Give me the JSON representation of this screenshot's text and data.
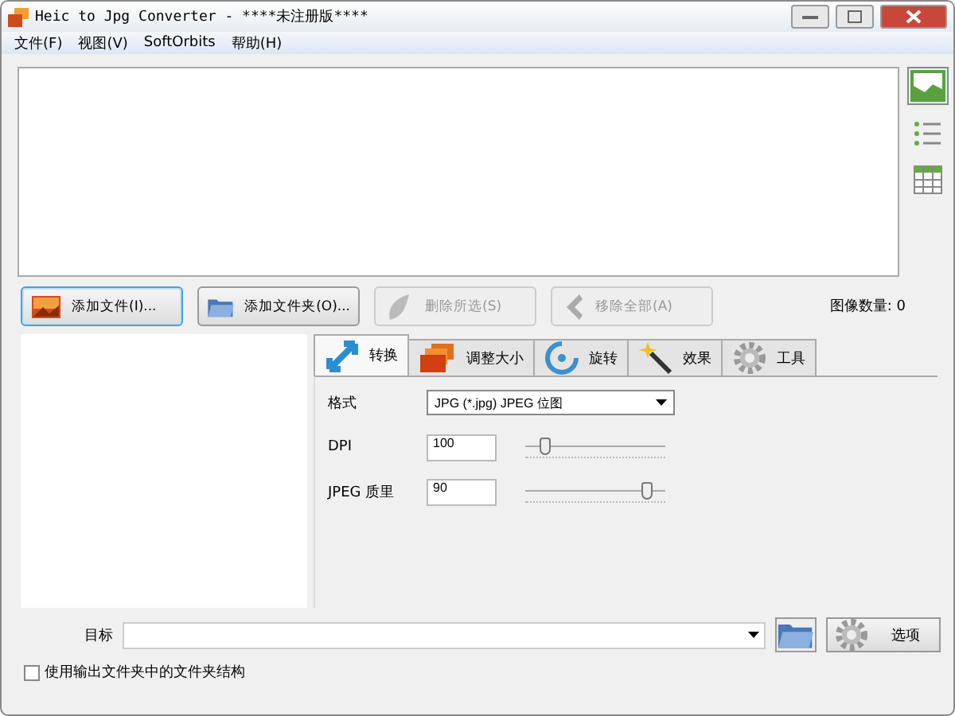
{
  "window": {
    "title": "Heic to Jpg Converter - ****未注册版****"
  },
  "menu": [
    {
      "label": "文件(F)"
    },
    {
      "label": "视图(V)"
    },
    {
      "label": "SoftOrbits"
    },
    {
      "label": "帮助(H)"
    }
  ],
  "view_buttons": [
    {
      "kind": "thumbnails",
      "selected": true
    },
    {
      "kind": "list",
      "selected": false
    },
    {
      "kind": "table",
      "selected": false
    }
  ],
  "actions": [
    {
      "kind": "add-file",
      "label": "添加文件(I)...",
      "disabled": false
    },
    {
      "kind": "add-folder",
      "label": "添加文件夹(O)...",
      "disabled": false
    },
    {
      "kind": "remove-selected",
      "label": "删除所选(S)",
      "disabled": true
    },
    {
      "kind": "remove-all",
      "label": "移除全部(A)",
      "disabled": true
    }
  ],
  "image_count": "图像数量: 0",
  "tabs": [
    {
      "kind": "convert",
      "label": "转换",
      "selected": true
    },
    {
      "kind": "resize",
      "label": "调整大小",
      "selected": false
    },
    {
      "kind": "rotate",
      "label": "旋转",
      "selected": false
    },
    {
      "kind": "effects",
      "label": "效果",
      "selected": false
    },
    {
      "kind": "tools",
      "label": "工具",
      "selected": false
    }
  ],
  "settings": [
    {
      "kind": "select",
      "label": "格式",
      "value": "JPG (*.jpg) JPEG 位图"
    },
    {
      "kind": "slider",
      "label": "DPI",
      "value": "100",
      "level": 0.15
    },
    {
      "kind": "slider",
      "label": "JPEG 质里",
      "value": "90",
      "level": 0.88
    }
  ],
  "target": {
    "label": "目标"
  },
  "options_button": {
    "label": "选项"
  },
  "keep_structure": {
    "label": "使用输出文件夹中的文件夹结构",
    "checked": false
  }
}
